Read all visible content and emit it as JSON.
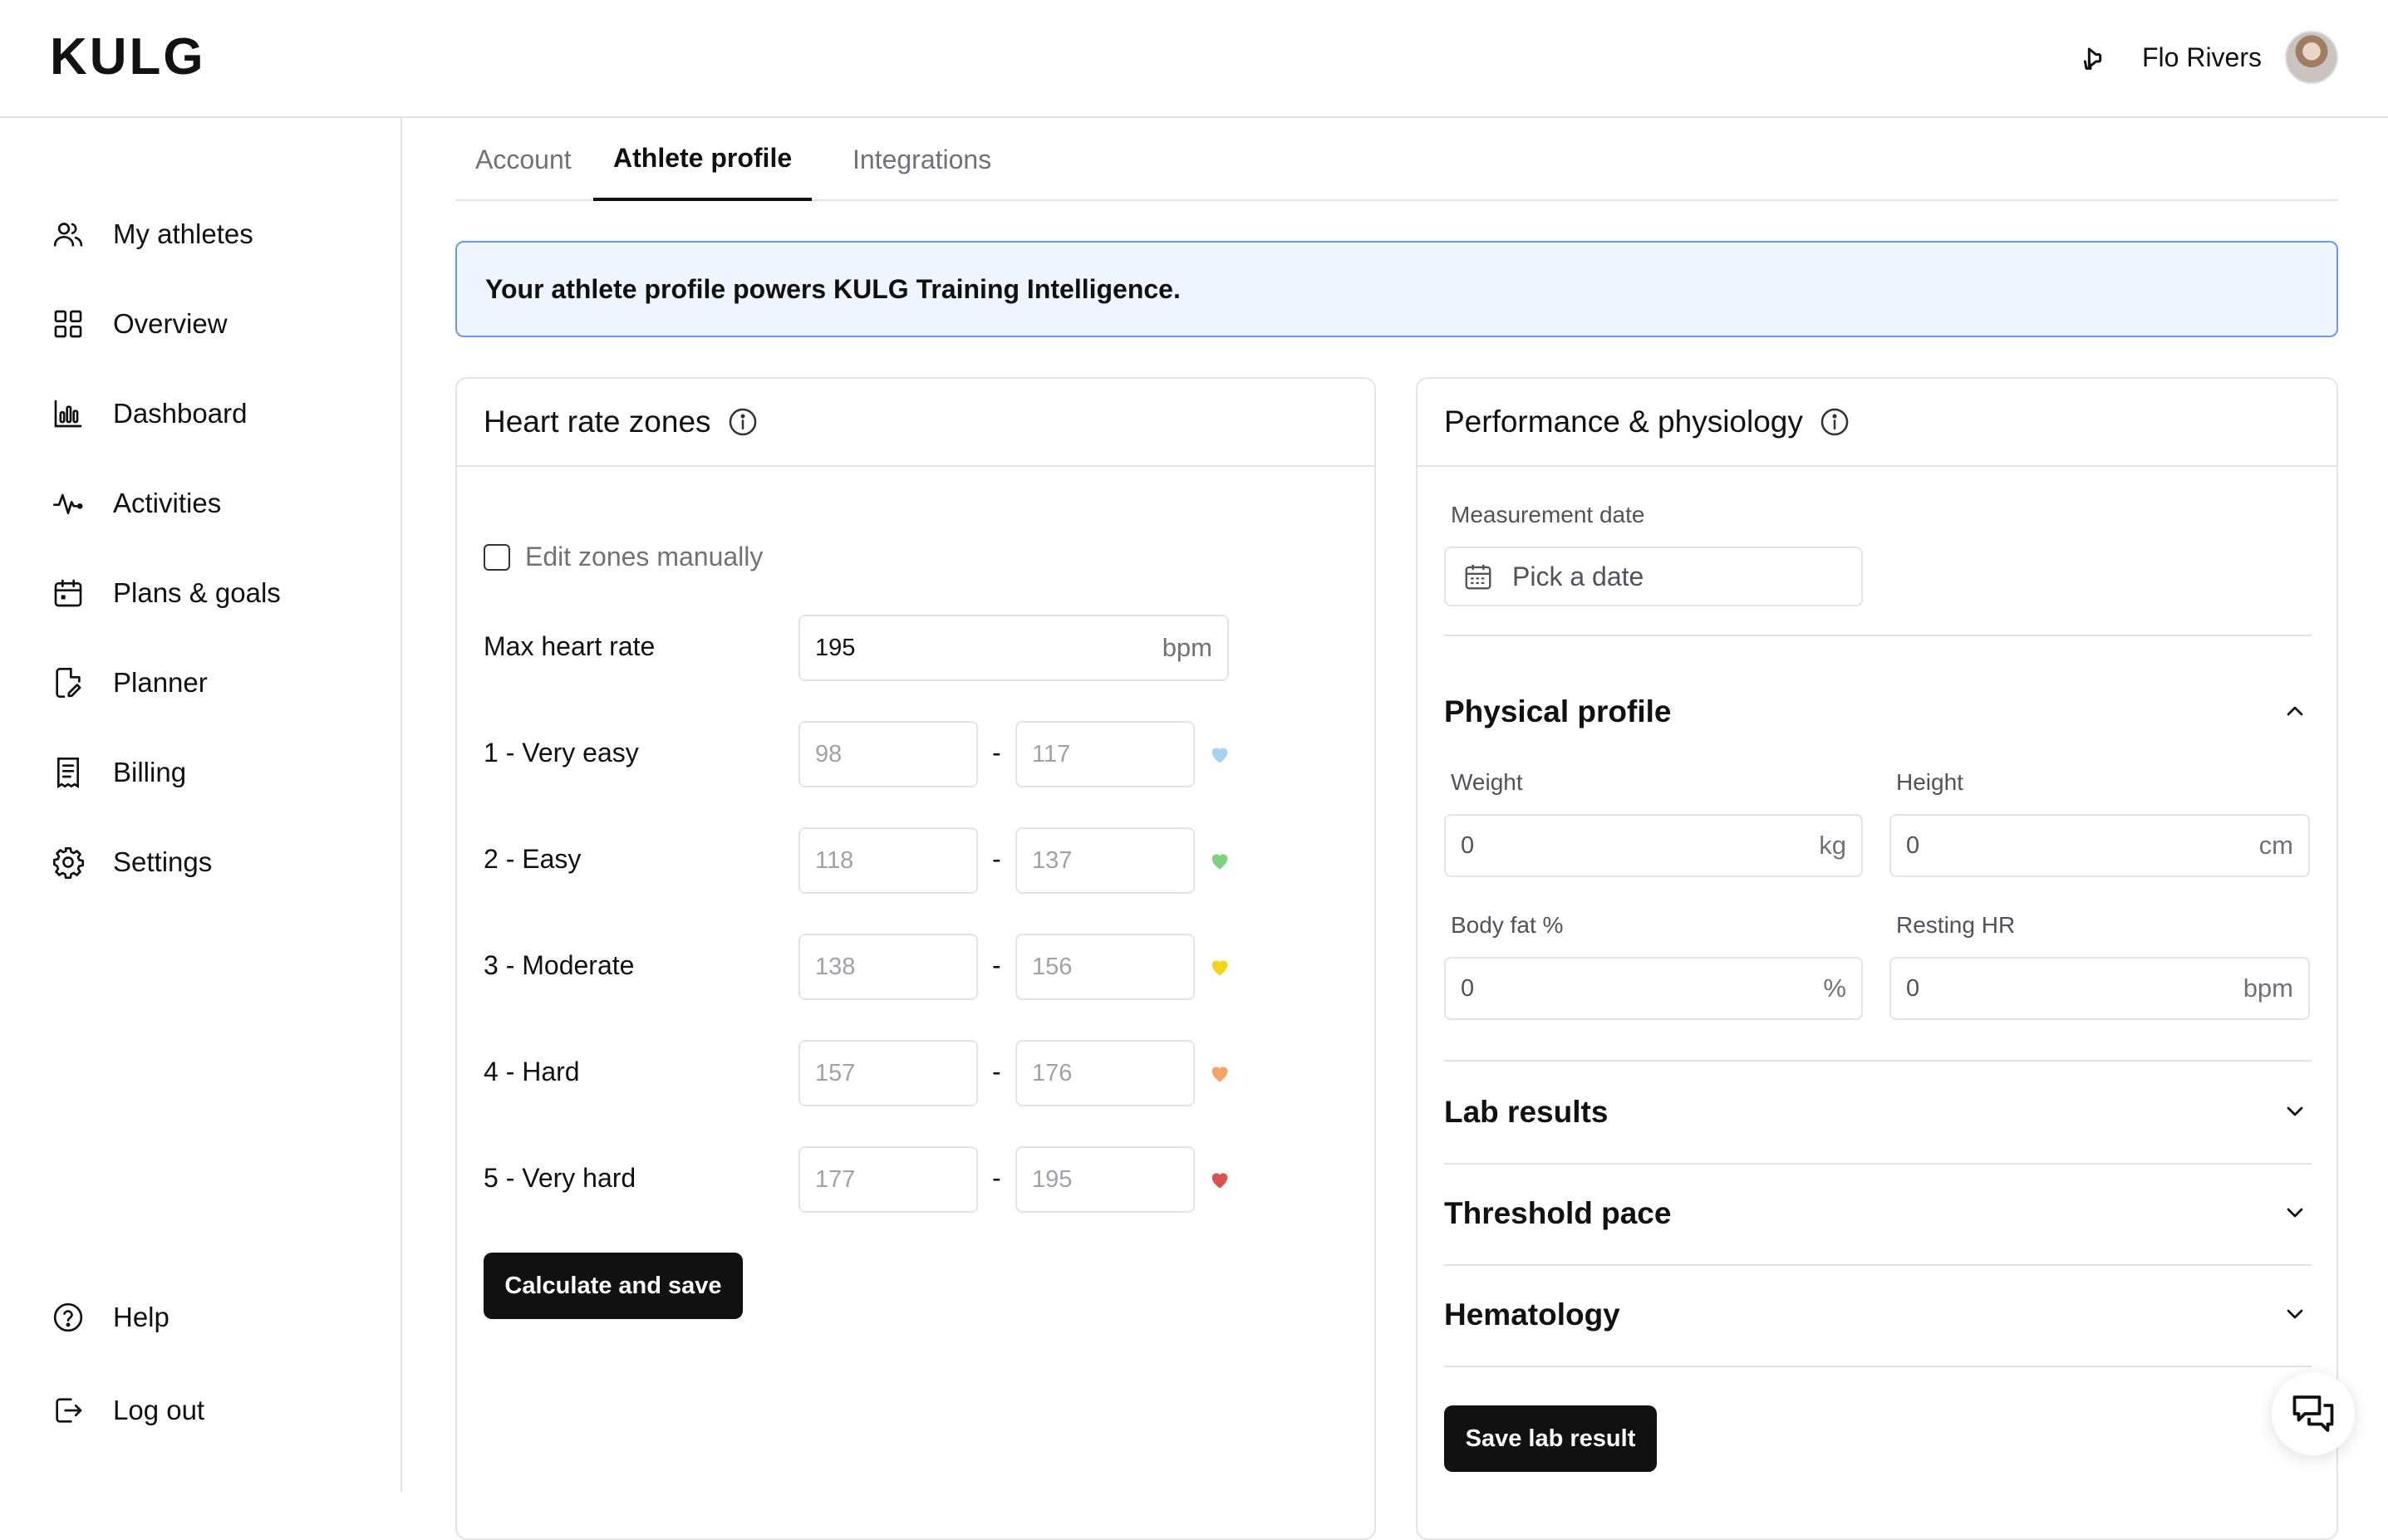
{
  "app": {
    "logo": "KULG"
  },
  "header": {
    "user_name": "Flo Rivers",
    "announce_icon": "megaphone-icon",
    "avatar_icon": "user-avatar"
  },
  "sidebar": {
    "items": [
      {
        "label": "My athletes",
        "icon": "users-icon"
      },
      {
        "label": "Overview",
        "icon": "grid-icon"
      },
      {
        "label": "Dashboard",
        "icon": "bar-chart-icon"
      },
      {
        "label": "Activities",
        "icon": "pulse-icon"
      },
      {
        "label": "Plans & goals",
        "icon": "calendar-icon"
      },
      {
        "label": "Planner",
        "icon": "file-edit-icon"
      },
      {
        "label": "Billing",
        "icon": "receipt-icon"
      },
      {
        "label": "Settings",
        "icon": "gear-icon"
      }
    ],
    "bottom": [
      {
        "label": "Help",
        "icon": "help-circle-icon"
      },
      {
        "label": "Log out",
        "icon": "logout-icon"
      }
    ]
  },
  "tabs": [
    {
      "label": "Account",
      "active": false
    },
    {
      "label": "Athlete profile",
      "active": true
    },
    {
      "label": "Integrations",
      "active": false
    }
  ],
  "banner": {
    "text": "Your athlete profile powers KULG Training Intelligence."
  },
  "hr_zones": {
    "title": "Heart rate zones",
    "edit_manually_label": "Edit zones manually",
    "edit_manually_checked": false,
    "max_hr_label": "Max heart rate",
    "max_hr_value": "195",
    "max_hr_unit": "bpm",
    "zones": [
      {
        "label": "1 - Very easy",
        "min": "98",
        "max": "117",
        "color": "#a8d2f0"
      },
      {
        "label": "2 - Easy",
        "min": "118",
        "max": "137",
        "color": "#7fd17f"
      },
      {
        "label": "3 - Moderate",
        "min": "138",
        "max": "156",
        "color": "#f2d61b"
      },
      {
        "label": "4 - Hard",
        "min": "157",
        "max": "176",
        "color": "#f5a36b"
      },
      {
        "label": "5 - Very hard",
        "min": "177",
        "max": "195",
        "color": "#d9534f"
      }
    ],
    "separator": "-",
    "button_label": "Calculate and save"
  },
  "performance": {
    "title": "Performance & physiology",
    "measurement_date_label": "Measurement date",
    "date_placeholder": "Pick a date",
    "physical_profile": {
      "title": "Physical profile",
      "expanded": true,
      "fields": [
        {
          "label": "Weight",
          "value": "0",
          "unit": "kg"
        },
        {
          "label": "Height",
          "value": "0",
          "unit": "cm"
        },
        {
          "label": "Body fat %",
          "value": "0",
          "unit": "%"
        },
        {
          "label": "Resting HR",
          "value": "0",
          "unit": "bpm"
        }
      ]
    },
    "sections": [
      {
        "title": "Lab results",
        "expanded": false
      },
      {
        "title": "Threshold pace",
        "expanded": false
      },
      {
        "title": "Hematology",
        "expanded": false
      }
    ],
    "save_button_label": "Save lab result"
  },
  "chat": {
    "icon": "chat-bubbles-icon"
  },
  "colors": {
    "banner_border": "#6a9be8",
    "banner_bg": "#eff5ff",
    "dark_button": "#111111"
  }
}
